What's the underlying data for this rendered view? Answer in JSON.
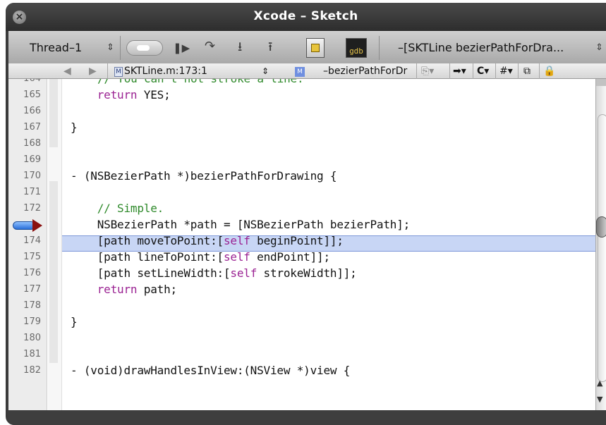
{
  "window": {
    "title": "Xcode – Sketch"
  },
  "toolbar": {
    "thread_label": "Thread–1",
    "method_label": "–[SKTLine bezierPathForDra..."
  },
  "navbar": {
    "file_label": "SKTLine.m:173:1",
    "symbol_label": "–bezierPathForDr"
  },
  "editor": {
    "top_partial_line": "// You can't not stroke a line.",
    "lines": [
      {
        "num": "165",
        "code": "    return YES;"
      },
      {
        "num": "166",
        "code": ""
      },
      {
        "num": "167",
        "code": "}"
      },
      {
        "num": "168",
        "code": ""
      },
      {
        "num": "169",
        "code": ""
      },
      {
        "num": "170",
        "code": "- (NSBezierPath *)bezierPathForDrawing {"
      },
      {
        "num": "171",
        "code": ""
      },
      {
        "num": "172",
        "code": "    // Simple."
      },
      {
        "num": "173",
        "code": "    NSBezierPath *path = [NSBezierPath bezierPath];"
      },
      {
        "num": "174",
        "code": "    [path moveToPoint:[self beginPoint]];"
      },
      {
        "num": "175",
        "code": "    [path lineToPoint:[self endPoint]];"
      },
      {
        "num": "176",
        "code": "    [path setLineWidth:[self strokeWidth]];"
      },
      {
        "num": "177",
        "code": "    return path;"
      },
      {
        "num": "178",
        "code": ""
      },
      {
        "num": "179",
        "code": "}"
      },
      {
        "num": "180",
        "code": ""
      },
      {
        "num": "181",
        "code": ""
      }
    ],
    "bottom_partial_line": "- (void)drawHandlesInView:(NSView *)view {",
    "current_line": "173"
  },
  "colors": {
    "keyword": "#9b2393",
    "comment": "#2f8a2b",
    "highlight": "#c8d6f5"
  },
  "icons": [
    "close-icon",
    "popup-arrows-icon",
    "breakpoints-toggle-icon",
    "continue-icon",
    "step-over-icon",
    "step-into-icon",
    "step-out-icon",
    "debugger-icon",
    "gdb-console-icon",
    "back-icon",
    "forward-icon",
    "file-m-icon",
    "method-m-icon",
    "bookmarks-icon",
    "breakpoints-menu-icon",
    "class-menu-icon",
    "includes-menu-icon",
    "counterparts-icon",
    "lock-icon",
    "scroll-up-icon",
    "scroll-down-icon",
    "program-counter-icon"
  ]
}
